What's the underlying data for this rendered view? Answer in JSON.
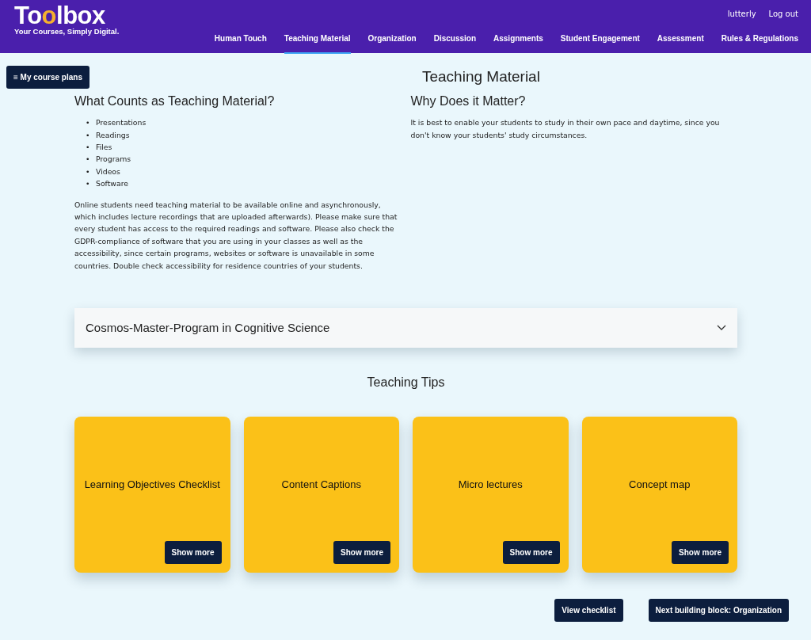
{
  "brand": {
    "logo": [
      {
        "text": "To",
        "accent": false
      },
      {
        "text": "o",
        "accent": true
      },
      {
        "text": "lbox",
        "accent": false
      }
    ],
    "tagline": "Your Courses, Simply Digital."
  },
  "user_links": [
    "lutterly",
    "Log out"
  ],
  "nav": [
    {
      "label": "Human Touch",
      "selected": false
    },
    {
      "label": "Teaching Material",
      "selected": true
    },
    {
      "label": "Organization",
      "selected": false
    },
    {
      "label": "Discussion",
      "selected": false
    },
    {
      "label": "Assignments",
      "selected": false
    },
    {
      "label": "Student Engagement",
      "selected": false
    },
    {
      "label": "Assessment",
      "selected": false
    },
    {
      "label": "Rules & Regulations",
      "selected": false
    }
  ],
  "menu_button": {
    "icon": "≡",
    "label": "My course plans"
  },
  "page_title": "Teaching Material",
  "left": {
    "heading": "What Counts as Teaching Material?",
    "items": [
      {
        "marker": "•",
        "text": "Presentations"
      },
      {
        "marker": "•",
        "text": "Readings"
      },
      {
        "marker": "•",
        "text": "Files"
      },
      {
        "marker": "•",
        "text": "Programs"
      },
      {
        "marker": "•",
        "text": "Videos"
      },
      {
        "marker": "•",
        "text": "Software"
      }
    ],
    "paragraph": "Online students need teaching material to be available online and asynchronously, which includes lecture recordings that are uploaded afterwards). Please make sure that every student has access to the required readings and software. Please also check the GDPR-compliance of software that you are using in your classes as well as the accessibility, since certain programs, websites or software is unavailable in some countries. Double check accessibility for residence countries of your students."
  },
  "right": {
    "heading": "Why Does it Matter?",
    "paragraph": "It is best to enable your students to study in their own pace and daytime, since you don't know your students' study circumstances."
  },
  "accordion": {
    "title": "Cosmos-Master-Program in Cognitive Science",
    "expanded": false
  },
  "tips": {
    "heading": "Teaching Tips",
    "cards": [
      {
        "title": "Learning Objectives Checklist",
        "button": "Show more"
      },
      {
        "title": "Content Captions",
        "button": "Show more"
      },
      {
        "title": "Micro lectures",
        "button": "Show more"
      },
      {
        "title": "Concept map",
        "button": "Show more"
      }
    ]
  },
  "footer_buttons": [
    "View checklist",
    "Next building block: Organization"
  ]
}
